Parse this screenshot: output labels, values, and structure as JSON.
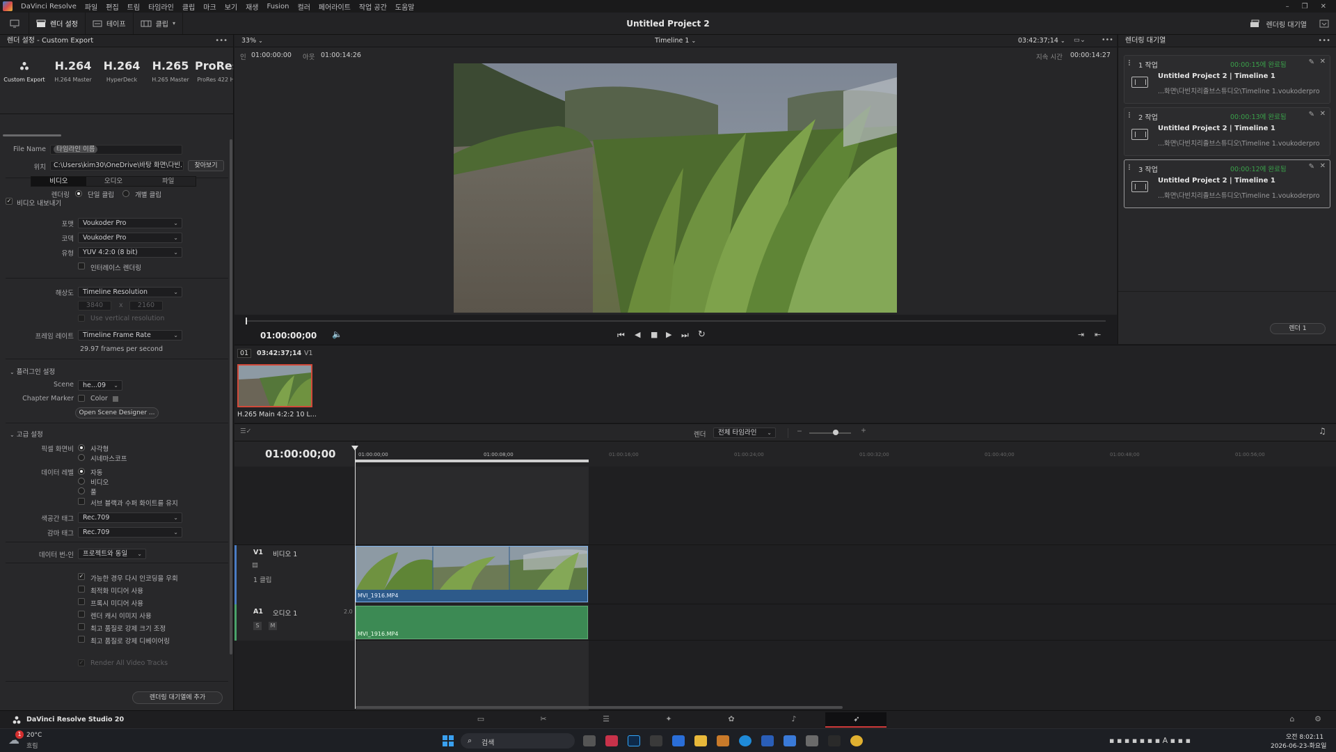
{
  "menubar": {
    "app_name": "DaVinci Resolve",
    "items": [
      "파일",
      "편집",
      "트림",
      "타임라인",
      "클립",
      "마크",
      "보기",
      "재생",
      "Fusion",
      "컬러",
      "페어라이트",
      "작업 공간",
      "도움말"
    ],
    "window_controls": [
      "–",
      "❐",
      "✕"
    ]
  },
  "toolbar": {
    "render_settings": "렌더 설정",
    "tape": "테이프",
    "clip": "클립",
    "project_title": "Untitled Project 2",
    "render_queue": "렌더링 대기열"
  },
  "render_settings": {
    "panel_title": "렌더 설정 - Custom Export",
    "presets": [
      {
        "big": "",
        "label": "Custom Export"
      },
      {
        "big": "H.264",
        "label": "H.264 Master"
      },
      {
        "big": "H.264",
        "label": "HyperDeck"
      },
      {
        "big": "H.265",
        "label": "H.265 Master"
      },
      {
        "big": "ProRes",
        "label": "ProRes 422 H"
      }
    ],
    "file_name_label": "File Name",
    "file_name_value": "타임라인 이름",
    "location_label": "위치",
    "location_value": "C:\\Users\\kim30\\OneDrive\\바탕 화면\\다빈...",
    "browse": "찾아보기",
    "render_label": "렌더링",
    "single_clip": "단일 클립",
    "individual_clips": "개별 클립",
    "tabs": [
      "비디오",
      "오디오",
      "파일"
    ],
    "export_video": "비디오 내보내기",
    "format_label": "포맷",
    "format_value": "Voukoder Pro",
    "codec_label": "코덱",
    "codec_value": "Voukoder Pro",
    "type_label": "유형",
    "type_value": "YUV 4:2:0 (8 bit)",
    "interlace": "인터레이스 렌더링",
    "resolution_label": "해상도",
    "resolution_value": "Timeline Resolution",
    "res_w": "3840",
    "res_x": "x",
    "res_h": "2160",
    "use_vertical": "Use vertical resolution",
    "frame_rate_label": "프레임 레이트",
    "frame_rate_value": "Timeline Frame Rate",
    "fps_text": "29.97 frames per second",
    "plugin_settings": "플러그인 설정",
    "scene_label": "Scene",
    "scene_value": "he...09",
    "chapter_label": "Chapter Marker",
    "color_label": "Color",
    "open_scene_designer": "Open Scene Designer ...",
    "advanced": "고급 설정",
    "pixel_aspect_label": "픽셀 화면비",
    "square": "사각형",
    "cinemascope": "시네마스코프",
    "data_levels_label": "데이터 레벨",
    "auto": "자동",
    "video": "비디오",
    "full": "풀",
    "retain_sub": "서브 블랙과 수퍼 화이트를 유지",
    "color_space_label": "색공간 태그",
    "color_space_value": "Rec.709",
    "gamma_label": "감마 태그",
    "gamma_value": "Rec.709",
    "data_burnin_label": "데이터 번-인",
    "data_burnin_value": "프로젝트와 동일",
    "bypass_reencode": "가능한 경우 다시 인코딩을 우회",
    "use_optimized": "최적화 미디어 사용",
    "use_proxy": "프록시 미디어 사용",
    "use_render_cache": "렌더 캐시 이미지 사용",
    "force_resize": "최고 품질로 강제 크기 조정",
    "force_debayer": "최고 품질로 강제 디베이어링",
    "render_all_video": "Render All Video Tracks",
    "add_to_queue": "렌더링 대기열에 추가"
  },
  "viewer": {
    "zoom": "33%",
    "timeline_name": "Timeline 1",
    "timecode_top": "03:42:37;14",
    "in_label": "인",
    "in_tc": "01:00:00:00",
    "out_label": "아웃",
    "out_tc": "01:00:14:26",
    "duration_label": "지속 시간",
    "duration_tc": "00:00:14:27",
    "current_tc": "01:00:00;00"
  },
  "render_queue": {
    "title": "렌더링 대기열",
    "jobs": [
      {
        "num": "1 작업",
        "time": "00:00:15에 완료됨",
        "title": "Untitled Project 2 | Timeline 1",
        "path": "...화면\\다빈치리졸브스튜디오\\Timeline 1.voukoderpro"
      },
      {
        "num": "2 작업",
        "time": "00:00:13에 완료됨",
        "title": "Untitled Project 2 | Timeline 1",
        "path": "...화면\\다빈치리졸브스튜디오\\Timeline 1.voukoderpro"
      },
      {
        "num": "3 작업",
        "time": "00:00:12에 완료됨",
        "title": "Untitled Project 2 | Timeline 1",
        "path": "...화면\\다빈치리졸브스튜디오\\Timeline 1.voukoderpro"
      }
    ],
    "render_button": "렌더 1"
  },
  "clips": {
    "index": "01",
    "tc": "03:42:37;14",
    "track": "V1",
    "clip_name": "H.265 Main 4:2:2 10 L..."
  },
  "timeline": {
    "render_label": "렌더",
    "render_scope": "전체 타임라인",
    "current_tc": "01:00:00;00",
    "ruler": [
      "01:00:00;00",
      "01:00:08;00",
      "01:00:16;00",
      "01:00:24;00",
      "01:00:32;00",
      "01:00:40;00",
      "01:00:48;00",
      "01:00:56;00"
    ],
    "v1_tag": "V1",
    "v1_name": "비디오 1",
    "v1_count": "1 클립",
    "a1_tag": "A1",
    "a1_name": "오디오 1",
    "a1_level": "2.0",
    "solo": "S",
    "mute": "M",
    "video_clip_name": "MVI_1916.MP4",
    "audio_clip_name": "MVI_1916.MP4"
  },
  "bottom": {
    "brand": "DaVinci Resolve Studio 20"
  },
  "taskbar": {
    "weather_temp": "20°C",
    "weather_desc": "흐림",
    "search": "검색",
    "time": "오전 8:02:11",
    "date": "2026-06-23-화요일",
    "badge": "1"
  }
}
